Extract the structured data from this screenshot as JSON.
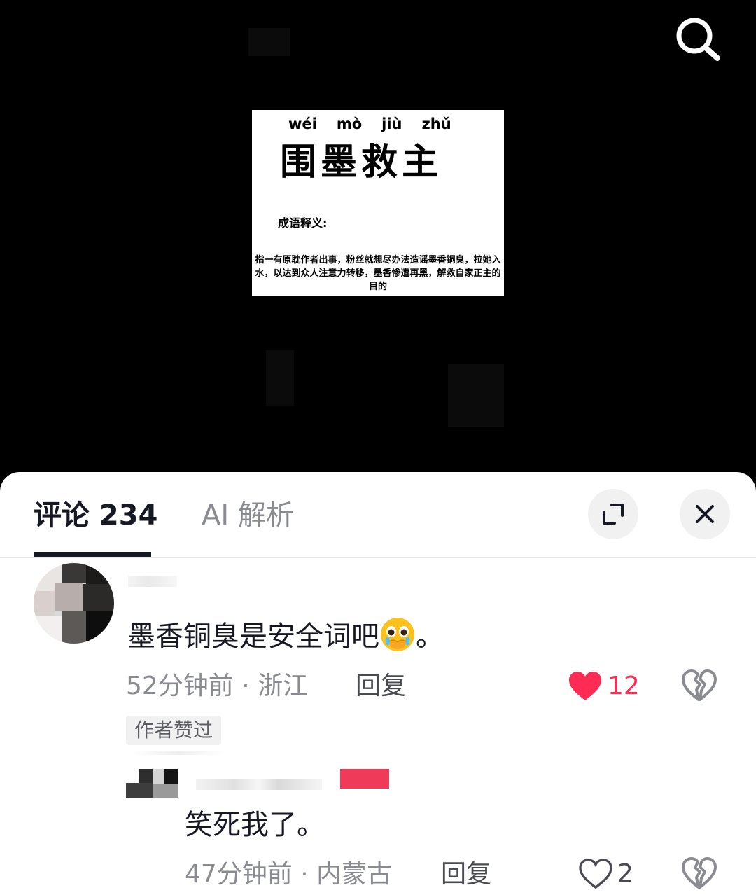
{
  "video": {
    "card": {
      "pinyin": [
        "wéi",
        "mò",
        "jiù",
        "zhǔ"
      ],
      "title": "围墨救主",
      "definition_label": "成语释义:",
      "definition": "指一有原耽作者出事，粉丝就想尽办法造谣墨香铜臭，拉她入水，以达到众人注意力转移，墨香惨遭再黑，解救自家正主的目的"
    },
    "search_icon": "search-icon"
  },
  "sheet": {
    "tabs": [
      {
        "label": "评论 234",
        "active": true
      },
      {
        "label": "AI 解析",
        "active": false
      }
    ],
    "expand_icon": "expand-icon",
    "close_icon": "close-icon"
  },
  "comments": [
    {
      "text": "墨香铜臭是安全词吧",
      "emoji": "crying-face-emoji",
      "text_suffix": "。",
      "time_location": "52分钟前 · 浙江",
      "reply_label": "回复",
      "likes": "12",
      "liked": true,
      "badge": "作者赞过"
    },
    {
      "text": "笑死我了。",
      "time_location": "47分钟前 · 内蒙古",
      "reply_label": "回复",
      "likes": "2",
      "liked": false
    }
  ],
  "colors": {
    "accent_red": "#fe2c55",
    "text_primary": "#161823",
    "text_secondary": "#8a8b91"
  }
}
